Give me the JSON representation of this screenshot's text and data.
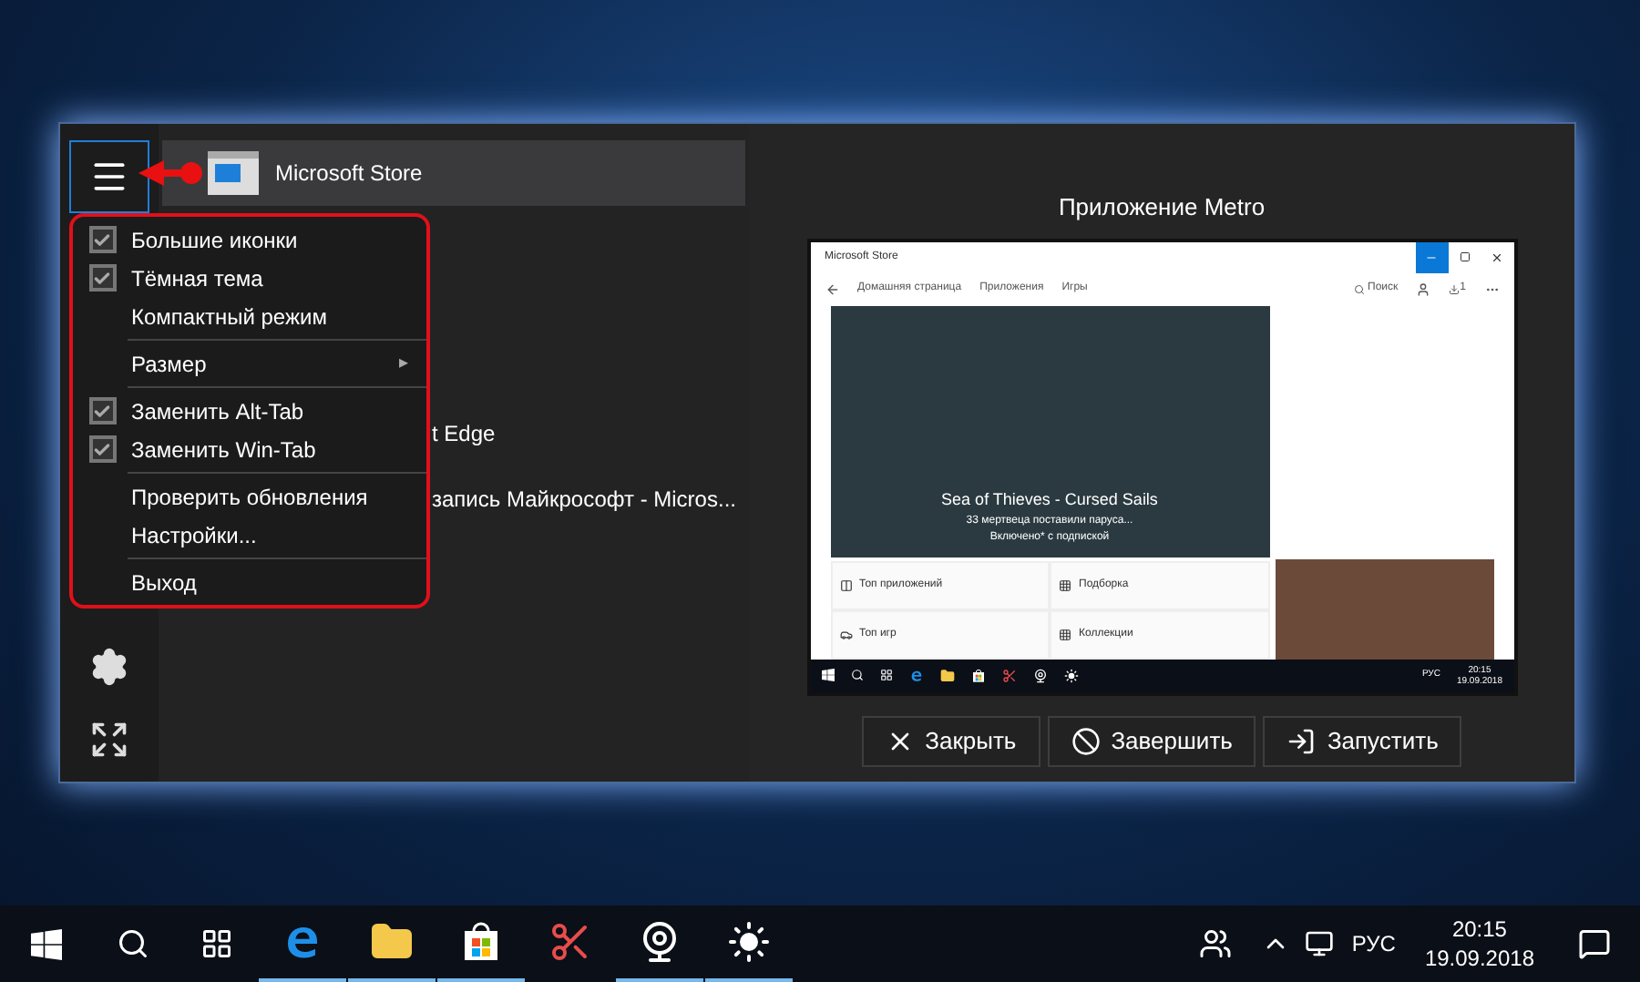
{
  "app_list": [
    {
      "name": "Microsoft Store",
      "selected": true
    },
    {
      "name": "t Edge",
      "selected": false
    },
    {
      "name": "запись Майкрософт - Micros...",
      "selected": false
    }
  ],
  "menu": [
    {
      "kind": "check",
      "label": "Большие иконки",
      "checked": true
    },
    {
      "kind": "check",
      "label": "Тёмная тема",
      "checked": true
    },
    {
      "kind": "check",
      "label": "Компактный режим",
      "checked": false
    },
    {
      "kind": "separator"
    },
    {
      "kind": "submenu",
      "label": "Размер",
      "arrow": "▸"
    },
    {
      "kind": "separator"
    },
    {
      "kind": "check",
      "label": "Заменить Alt-Tab",
      "checked": true
    },
    {
      "kind": "check",
      "label": "Заменить Win-Tab",
      "checked": true
    },
    {
      "kind": "separator"
    },
    {
      "kind": "check",
      "label": "Проверить обновления",
      "checked": false
    },
    {
      "kind": "check",
      "label": "Настройки...",
      "checked": false
    },
    {
      "kind": "separator"
    },
    {
      "kind": "check",
      "label": "Выход",
      "checked": false
    }
  ],
  "preview": {
    "title": "Приложение Metro",
    "window_title": "Microsoft Store",
    "nav": [
      "Домашняя страница",
      "Приложения",
      "Игры"
    ],
    "search": "Поиск",
    "downloads": "1",
    "hero_title": "Sea of Thieves - Cursed Sails",
    "hero_lines": [
      "33 мертвеца поставили паруса...",
      "Включено* с подпиской"
    ],
    "tiles": [
      "Топ приложений",
      "Подборка",
      "Топ игр",
      "Коллекции"
    ],
    "tray_lang": "РУС",
    "tray_time": "20:15",
    "tray_date": "19.09.2018"
  },
  "buttons": [
    {
      "label": "Закрыть"
    },
    {
      "label": "Завершить"
    },
    {
      "label": "Запустить"
    }
  ],
  "taskbar": {
    "apps": [
      {
        "running": true
      },
      {
        "running": true
      },
      {
        "running": true
      },
      {
        "running": false
      },
      {
        "running": true
      },
      {
        "running": true
      }
    ],
    "lang": "РУС",
    "time": "20:15",
    "date": "19.09.2018"
  }
}
